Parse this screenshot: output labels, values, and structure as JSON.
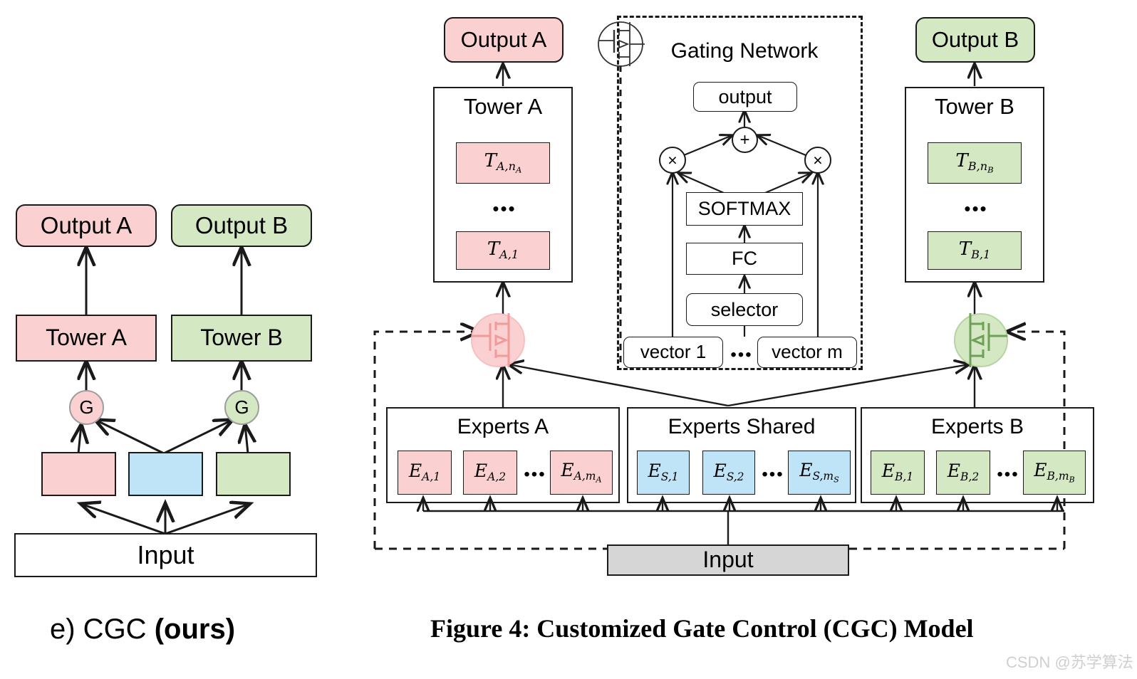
{
  "figure": {
    "left_caption_plain": "e) CGC ",
    "left_caption_bold": "(ours)",
    "right_caption": "Figure 4: Customized Gate Control (CGC) Model",
    "watermark": "CSDN @苏学算法"
  },
  "colors": {
    "pink": "#fad0d0",
    "green": "#d5e8c4",
    "blue": "#bfe3f7",
    "gray": "#d6d6d6",
    "white": "#ffffff",
    "stroke": "#1a1a1a",
    "pink_stroke": "#f4a8a8",
    "green_stroke": "#7ea86a",
    "watermark": "#cfcfcf"
  },
  "left_panel": {
    "output_a": "Output A",
    "output_b": "Output B",
    "tower_a": "Tower A",
    "tower_b": "Tower B",
    "gate_a": "G",
    "gate_b": "G",
    "input": "Input",
    "expert_blocks": [
      "",
      "",
      ""
    ]
  },
  "right_panel": {
    "output_a": "Output A",
    "output_b": "Output B",
    "tower_a": {
      "title": "Tower A",
      "top_layer": "T",
      "top_sub": "A,n",
      "top_sub_sub": "A",
      "ellipsis": "•••",
      "bottom_layer": "T",
      "bottom_sub": "A,1"
    },
    "tower_b": {
      "title": "Tower B",
      "top_layer": "T",
      "top_sub": "B,n",
      "top_sub_sub": "B",
      "ellipsis": "•••",
      "bottom_layer": "T",
      "bottom_sub": "B,1"
    },
    "gating_network": {
      "title": "Gating Network",
      "output": "output",
      "plus": "+",
      "mult_left": "×",
      "mult_right": "×",
      "softmax": "SOFTMAX",
      "fc": "FC",
      "selector": "selector",
      "vector_first": "vector 1",
      "vector_ellipsis": "•••",
      "vector_last": "vector m"
    },
    "experts_a": {
      "title": "Experts A",
      "e1": "E",
      "e1_sub": "A,1",
      "e2": "E",
      "e2_sub": "A,2",
      "ellipsis": "•••",
      "e3": "E",
      "e3_sub": "A,m",
      "e3_sub_sub": "A"
    },
    "experts_shared": {
      "title": "Experts Shared",
      "e1": "E",
      "e1_sub": "S,1",
      "e2": "E",
      "e2_sub": "S,2",
      "ellipsis": "•••",
      "e3": "E",
      "e3_sub": "S,m",
      "e3_sub_sub": "S"
    },
    "experts_b": {
      "title": "Experts B",
      "e1": "E",
      "e1_sub": "B,1",
      "e2": "E",
      "e2_sub": "B,2",
      "ellipsis": "•••",
      "e3": "E",
      "e3_sub": "B,m",
      "e3_sub_sub": "B"
    },
    "input": "Input"
  }
}
